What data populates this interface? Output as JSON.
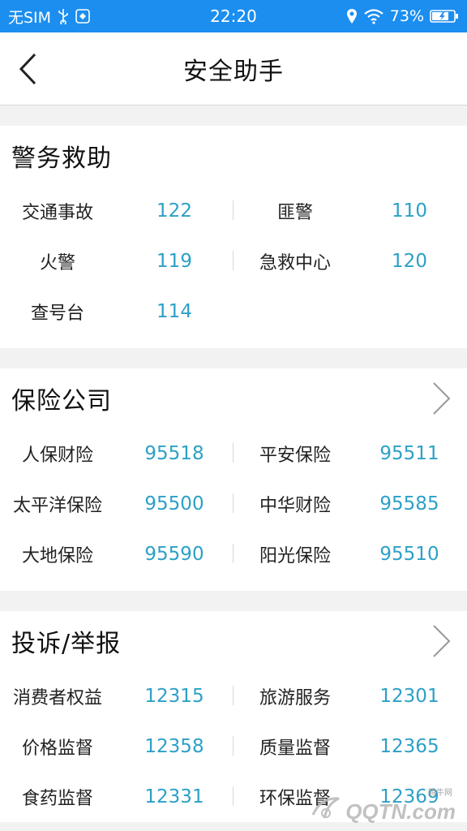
{
  "status_bar": {
    "carrier": "无SIM",
    "time": "22:20",
    "battery": "73%"
  },
  "nav": {
    "title": "安全助手"
  },
  "sections": [
    {
      "title": "警务救助",
      "has_arrow": false,
      "items": [
        {
          "name": "交通事故",
          "phone": "122"
        },
        {
          "name": "匪警",
          "phone": "110"
        },
        {
          "name": "火警",
          "phone": "119"
        },
        {
          "name": "急救中心",
          "phone": "120"
        },
        {
          "name": "查号台",
          "phone": "114"
        }
      ]
    },
    {
      "title": "保险公司",
      "has_arrow": true,
      "items": [
        {
          "name": "人保财险",
          "phone": "95518"
        },
        {
          "name": "平安保险",
          "phone": "95511"
        },
        {
          "name": "太平洋保险",
          "phone": "95500"
        },
        {
          "name": "中华财险",
          "phone": "95585"
        },
        {
          "name": "大地保险",
          "phone": "95590"
        },
        {
          "name": "阳光保险",
          "phone": "95510"
        }
      ]
    },
    {
      "title": "投诉/举报",
      "has_arrow": true,
      "items": [
        {
          "name": "消费者权益",
          "phone": "12315"
        },
        {
          "name": "旅游服务",
          "phone": "12301"
        },
        {
          "name": "价格监督",
          "phone": "12358"
        },
        {
          "name": "质量监督",
          "phone": "12365"
        },
        {
          "name": "食药监督",
          "phone": "12331"
        },
        {
          "name": "环保监督",
          "phone": "12369"
        }
      ]
    }
  ],
  "watermark": {
    "text": "QQTN.com",
    "small": "腾牛网"
  },
  "colors": {
    "status_bar_bg": "#1b8ef0",
    "phone_text": "#2ca0c6",
    "page_bg": "#f2f2f2"
  }
}
